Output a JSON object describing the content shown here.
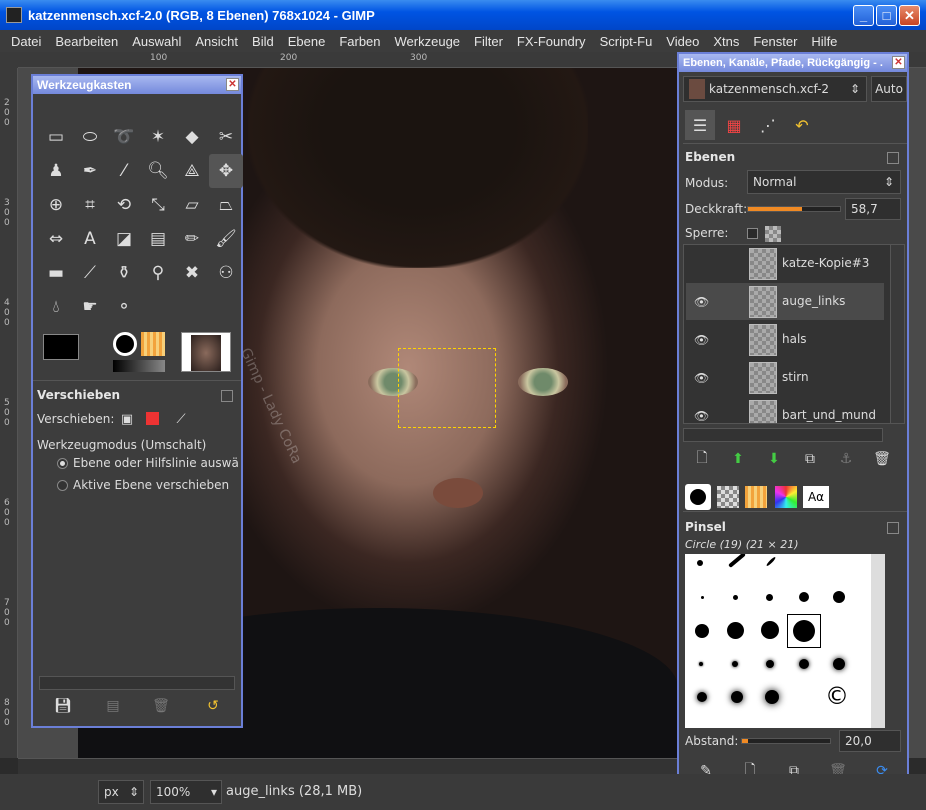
{
  "window": {
    "title": "katzenmensch.xcf-2.0 (RGB, 8 Ebenen) 768x1024 - GIMP",
    "minimize": "_",
    "maximize": "□",
    "close": "✕"
  },
  "menubar": [
    "Datei",
    "Bearbeiten",
    "Auswahl",
    "Ansicht",
    "Bild",
    "Ebene",
    "Farben",
    "Werkzeuge",
    "Filter",
    "FX-Foundry",
    "Script-Fu",
    "Video",
    "Xtns",
    "Fenster",
    "Hilfe"
  ],
  "rulers": {
    "h": [
      "100",
      "200",
      "300"
    ],
    "v": [
      "200",
      "300",
      "400",
      "500",
      "600",
      "700",
      "800"
    ]
  },
  "toolbox": {
    "title": "Werkzeugkasten",
    "tool_options_title": "Verschieben",
    "move_label": "Verschieben:",
    "mode_label": "Werkzeugmodus (Umschalt)",
    "option_1": "Ebene oder Hilfslinie auswählen",
    "option_2": "Aktive Ebene verschieben"
  },
  "layers_dock": {
    "title": "Ebenen, Kanäle, Pfade, Rückgängig - ...",
    "image_combo": "katzenmensch.xcf-2",
    "auto_button": "Auto",
    "section": "Ebenen",
    "mode_label": "Modus:",
    "mode_value": "Normal",
    "opacity_label": "Deckkraft:",
    "opacity_value": "58,7",
    "opacity_fraction": 0.587,
    "lock_label": "Sperre:",
    "layers": [
      {
        "name": "katze-Kopie#3",
        "visible": false
      },
      {
        "name": "auge_links",
        "visible": true
      },
      {
        "name": "hals",
        "visible": true
      },
      {
        "name": "stirn",
        "visible": true
      },
      {
        "name": "bart_und_mund",
        "visible": true
      }
    ],
    "brush_section": "Pinsel",
    "brush_name": "Circle (19) (21 × 21)",
    "spacing_label": "Abstand:",
    "spacing_value": "20,0",
    "text_tab": "Aα"
  },
  "status": {
    "unit": "px",
    "zoom": "100%",
    "info": "auge_links (28,1 MB)"
  },
  "watermark": "Gimp - Lady CoRa"
}
